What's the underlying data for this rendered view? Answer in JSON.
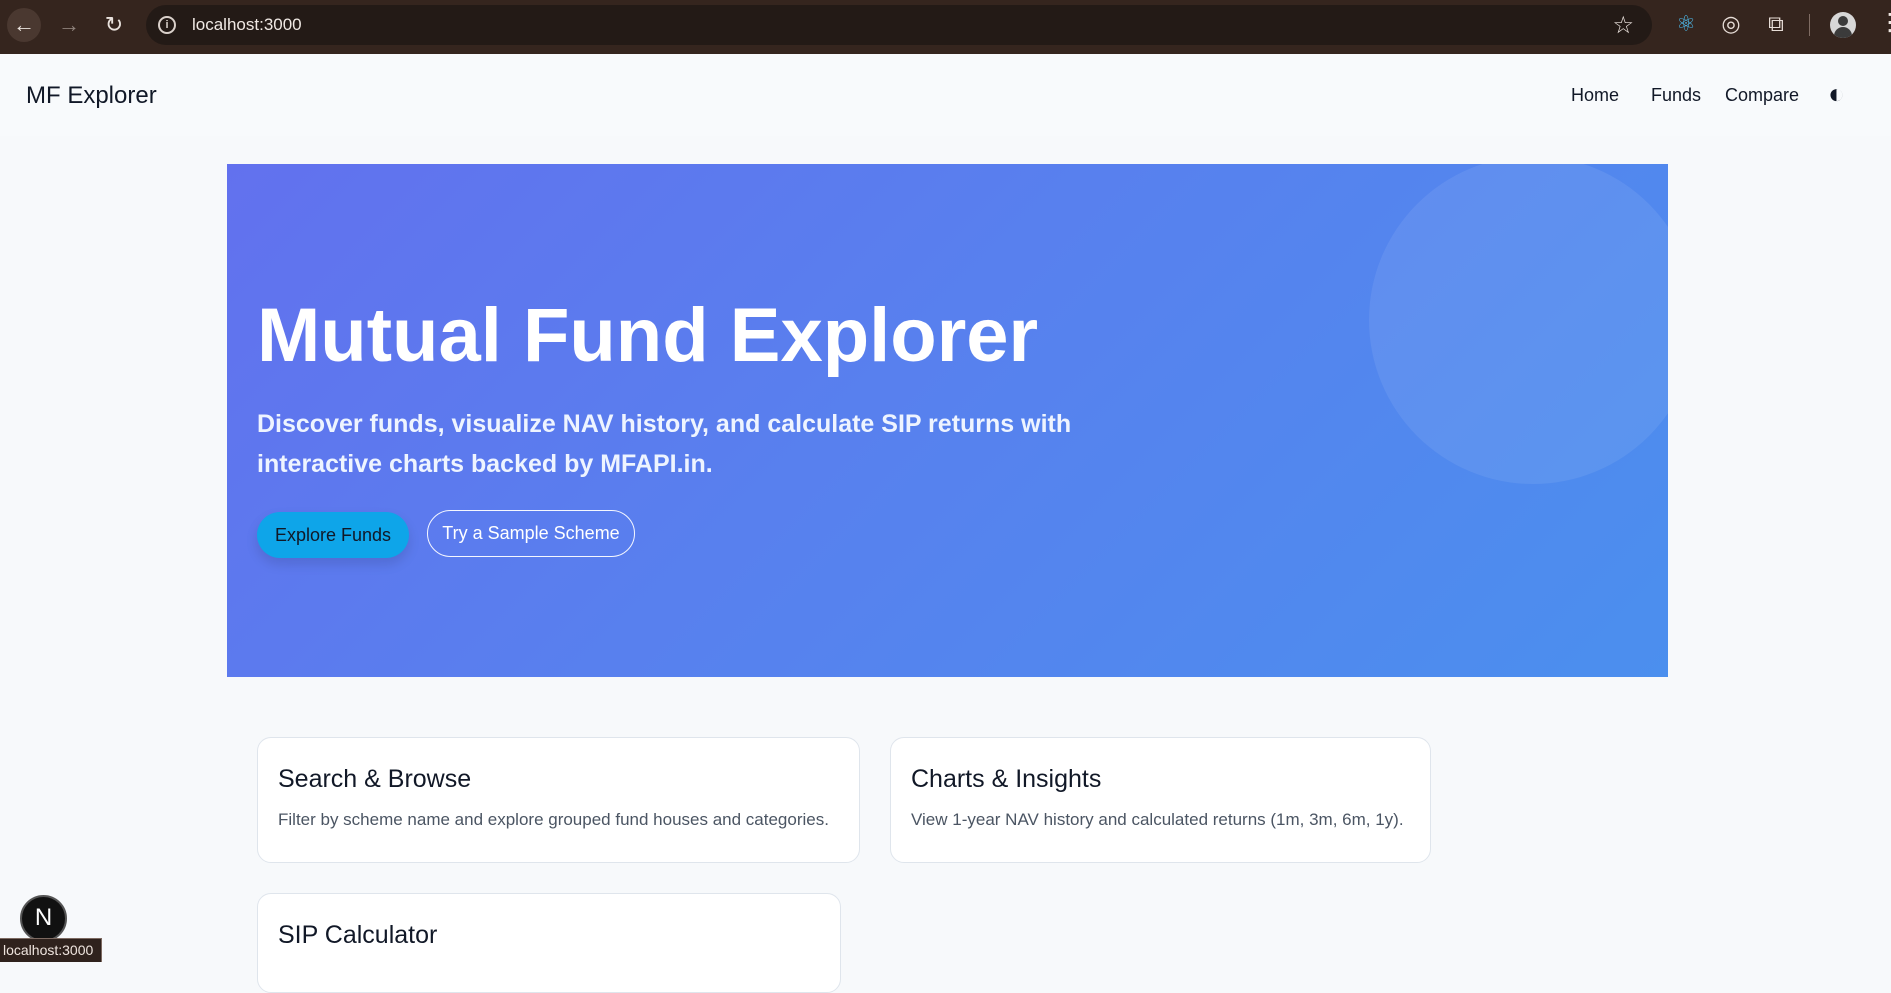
{
  "browser": {
    "url": "localhost:3000",
    "status_url": "localhost:3000"
  },
  "site": {
    "brand": "MF Explorer",
    "nav": {
      "home": "Home",
      "funds": "Funds",
      "compare": "Compare"
    }
  },
  "hero": {
    "title": "Mutual Fund Explorer",
    "subtitle": "Discover funds, visualize NAV history, and calculate SIP returns with interactive charts backed by MFAPI.in.",
    "primary_button": "Explore Funds",
    "secondary_button": "Try a Sample Scheme"
  },
  "features": [
    {
      "title": "Search & Browse",
      "description": "Filter by scheme name and explore grouped fund houses and categories."
    },
    {
      "title": "Charts & Insights",
      "description": "View 1-year NAV history and calculated returns (1m, 3m, 6m, 1y)."
    },
    {
      "title": "SIP Calculator"
    }
  ],
  "icons": {
    "back": "back-arrow-icon",
    "forward": "forward-arrow-icon",
    "reload": "reload-icon",
    "info": "info-icon",
    "star": "star-icon",
    "theme": "theme-toggle-icon",
    "nextjs": "nextjs-icon"
  },
  "colors": {
    "hero_gradient_start": "#6271ee",
    "hero_gradient_end": "#4b8fee",
    "primary_button": "#0ea5e9",
    "browser_chrome": "#35251e"
  }
}
